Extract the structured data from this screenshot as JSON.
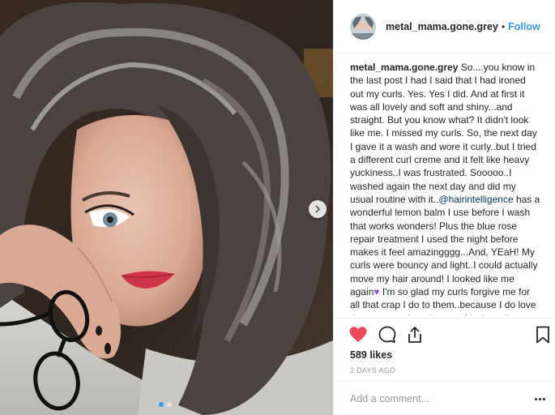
{
  "post": {
    "username": "metal_mama.gone.grey",
    "separator": "•",
    "follow_label": "Follow",
    "caption": {
      "username": "metal_mama.gone.grey",
      "text_before_mention": "So....you know in the last post I had I said that I had ironed out my curls. Yes. Yes I did. And at first it was all lovely and soft and shiny...and straight. But you know what? It didn't look like me. I missed my curls. So, the next day I gave it a wash and wore it curly..but I tried a different curl creme and it felt like heavy yuckiness..I was frustrated. Sooooo..I washed again the next day and did my usual routine with it..",
      "mention": "@hairintelligence",
      "text_before_emoji": " has a wonderful lemon balm I use before I wash that works wonders! Plus the blue rose repair treatment I used the night before makes it feel amazingggg...And, YEaH! My curls were bouncy and light..I could actually move my hair around! I looked like me again",
      "emoji": "♥",
      "text_after_emoji": " I'm so glad my curls forgive me for all that crap I do to them..because I do love them..even when they get frizzly and"
    },
    "likes": "589 likes",
    "date": "2 DAYS AGO",
    "comment_placeholder": "Add a comment...",
    "liked": true,
    "carousel": {
      "slide_count": 2,
      "current_slide": 1
    }
  },
  "icons": {
    "like": "heart-icon",
    "comment": "comment-icon",
    "share": "share-icon",
    "save": "bookmark-icon",
    "next": "chevron-right-icon",
    "more": "more-options-icon"
  },
  "colors": {
    "accent": "#3897f0",
    "like": "#ed4956",
    "mention": "#003569",
    "muted": "#999999",
    "text": "#262626"
  }
}
